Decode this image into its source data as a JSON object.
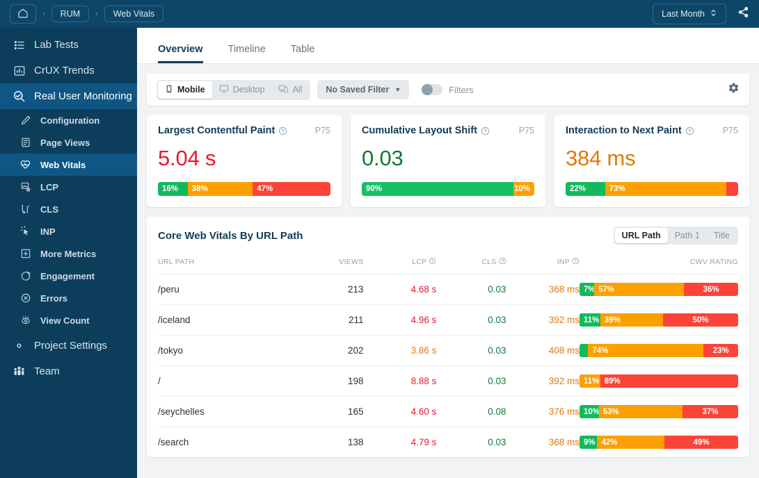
{
  "topbar": {
    "home_icon": "home-icon",
    "breadcrumbs": [
      "RUM",
      "Web Vitals"
    ],
    "separator": "›",
    "date_range": "Last Month",
    "date_caret": "⌃⌄",
    "share_icon": "share-icon"
  },
  "sidebar": {
    "top_items": [
      {
        "label": "Lab Tests",
        "icon": "list-icon"
      },
      {
        "label": "CrUX Trends",
        "icon": "bar-chart-icon"
      },
      {
        "label": "Real User Monitoring",
        "icon": "search-insight-icon",
        "active": true
      }
    ],
    "sub_items": [
      {
        "label": "Configuration",
        "icon": "pencil-icon"
      },
      {
        "label": "Page Views",
        "icon": "document-icon"
      },
      {
        "label": "Web Vitals",
        "icon": "heart-pulse-icon",
        "active": true
      },
      {
        "label": "LCP",
        "icon": "image-view-icon"
      },
      {
        "label": "CLS",
        "icon": "shift-arrows-icon"
      },
      {
        "label": "INP",
        "icon": "click-cursor-icon"
      },
      {
        "label": "More Metrics",
        "icon": "plus-box-icon"
      },
      {
        "label": "Engagement",
        "icon": "engagement-icon"
      },
      {
        "label": "Errors",
        "icon": "error-circle-icon"
      },
      {
        "label": "View Count",
        "icon": "eye-count-icon"
      }
    ],
    "bottom_items": [
      {
        "label": "Project Settings",
        "icon": "gear-icon"
      },
      {
        "label": "Team",
        "icon": "people-icon"
      }
    ]
  },
  "tabs": [
    {
      "label": "Overview",
      "active": true
    },
    {
      "label": "Timeline",
      "active": false
    },
    {
      "label": "Table",
      "active": false
    }
  ],
  "filterbar": {
    "devices": [
      {
        "label": "Mobile",
        "icon": "mobile-icon",
        "active": true
      },
      {
        "label": "Desktop",
        "icon": "desktop-icon",
        "active": false
      },
      {
        "label": "All",
        "icon": "all-devices-icon",
        "active": false
      }
    ],
    "saved_filter": "No Saved Filter",
    "saved_filter_caret": "▼",
    "filters_toggle_label": "Filters",
    "filters_toggle_on": false,
    "settings_icon": "gear-icon"
  },
  "metric_cards": [
    {
      "title": "Largest Contentful Paint",
      "help_icon": "help-circle-icon",
      "percentile": "P75",
      "value": "5.04 s",
      "value_color": "#e8192c",
      "segments": [
        {
          "label": "16%",
          "pct": 16,
          "color": "#12b95c"
        },
        {
          "label": "38%",
          "pct": 38,
          "color": "#fca000"
        },
        {
          "label": "47%",
          "pct": 46,
          "color": "#fb4338"
        }
      ]
    },
    {
      "title": "Cumulative Layout Shift",
      "help_icon": "help-circle-icon",
      "percentile": "P75",
      "value": "0.03",
      "value_color": "#0f7a33",
      "segments": [
        {
          "label": "90%",
          "pct": 90,
          "color": "#14c062"
        },
        {
          "label": "10%",
          "pct": 10,
          "color": "#fca000",
          "align": "right"
        }
      ]
    },
    {
      "title": "Interaction to Next Paint",
      "help_icon": "help-circle-icon",
      "percentile": "P75",
      "value": "384 ms",
      "value_color": "#e07a0b",
      "segments": [
        {
          "label": "22%",
          "pct": 22,
          "color": "#12b95c"
        },
        {
          "label": "73%",
          "pct": 73,
          "color": "#fca000"
        },
        {
          "label": "",
          "pct": 5,
          "color": "#fb4338"
        }
      ]
    }
  ],
  "table": {
    "title": "Core Web Vitals By URL Path",
    "group_by": [
      {
        "label": "URL Path",
        "active": true
      },
      {
        "label": "Path 1",
        "active": false
      },
      {
        "label": "Title",
        "active": false
      }
    ],
    "columns": [
      {
        "label": "URL PATH",
        "help": false
      },
      {
        "label": "VIEWS",
        "help": false
      },
      {
        "label": "LCP",
        "help": true
      },
      {
        "label": "CLS",
        "help": true
      },
      {
        "label": "INP",
        "help": true
      },
      {
        "label": "CWV RATING",
        "help": false
      }
    ],
    "rows": [
      {
        "url": "/peru",
        "views": "213",
        "lcp": "4.68 s",
        "lcp_color": "#e8192c",
        "cls": "0.03",
        "cls_color": "#0f7a33",
        "inp": "368 ms",
        "inp_color": "#e07a0b",
        "segments": [
          {
            "label": "7%",
            "pct": 7,
            "color": "#12b95c"
          },
          {
            "label": "57%",
            "pct": 57,
            "color": "#fca000"
          },
          {
            "label": "36%",
            "pct": 36,
            "color": "#fb4338",
            "align": "center"
          }
        ]
      },
      {
        "url": "/iceland",
        "views": "211",
        "lcp": "4.96 s",
        "lcp_color": "#e8192c",
        "cls": "0.03",
        "cls_color": "#0f7a33",
        "inp": "392 ms",
        "inp_color": "#e07a0b",
        "segments": [
          {
            "label": "11%",
            "pct": 11,
            "color": "#12b95c"
          },
          {
            "label": "39%",
            "pct": 39,
            "color": "#fca000"
          },
          {
            "label": "50%",
            "pct": 50,
            "color": "#fb4338",
            "align": "center"
          }
        ]
      },
      {
        "url": "/tokyo",
        "views": "202",
        "lcp": "3.86 s",
        "lcp_color": "#e07a0b",
        "cls": "0.03",
        "cls_color": "#0f7a33",
        "inp": "408 ms",
        "inp_color": "#e07a0b",
        "segments": [
          {
            "label": "",
            "pct": 3,
            "color": "#12b95c"
          },
          {
            "label": "74%",
            "pct": 74,
            "color": "#fca000"
          },
          {
            "label": "23%",
            "pct": 23,
            "color": "#fb4338",
            "align": "center"
          }
        ]
      },
      {
        "url": "/",
        "views": "198",
        "lcp": "8.88 s",
        "lcp_color": "#e8192c",
        "cls": "0.03",
        "cls_color": "#0f7a33",
        "inp": "392 ms",
        "inp_color": "#e07a0b",
        "segments": [
          {
            "label": "11%",
            "pct": 11,
            "color": "#fca000"
          },
          {
            "label": "89%",
            "pct": 89,
            "color": "#fb4338"
          }
        ]
      },
      {
        "url": "/seychelles",
        "views": "165",
        "lcp": "4.60 s",
        "lcp_color": "#e8192c",
        "cls": "0.08",
        "cls_color": "#0f7a33",
        "inp": "376 ms",
        "inp_color": "#e07a0b",
        "segments": [
          {
            "label": "10%",
            "pct": 10,
            "color": "#12b95c"
          },
          {
            "label": "53%",
            "pct": 53,
            "color": "#fca000"
          },
          {
            "label": "37%",
            "pct": 37,
            "color": "#fb4338",
            "align": "center"
          }
        ]
      },
      {
        "url": "/search",
        "views": "138",
        "lcp": "4.79 s",
        "lcp_color": "#e8192c",
        "cls": "0.03",
        "cls_color": "#0f7a33",
        "inp": "368 ms",
        "inp_color": "#e07a0b",
        "segments": [
          {
            "label": "9%",
            "pct": 9,
            "color": "#12b95c"
          },
          {
            "label": "42%",
            "pct": 42,
            "color": "#fca000"
          },
          {
            "label": "49%",
            "pct": 49,
            "color": "#fb4338",
            "align": "center"
          }
        ]
      }
    ]
  },
  "colors": {
    "sidebar_bg": "#0c3e5c",
    "sidebar_active": "#0f5684",
    "topbar_bg": "#0d4668",
    "good": "#12b95c",
    "needs_improvement": "#fca000",
    "poor": "#fb4338",
    "accent_dark": "#123a57"
  }
}
